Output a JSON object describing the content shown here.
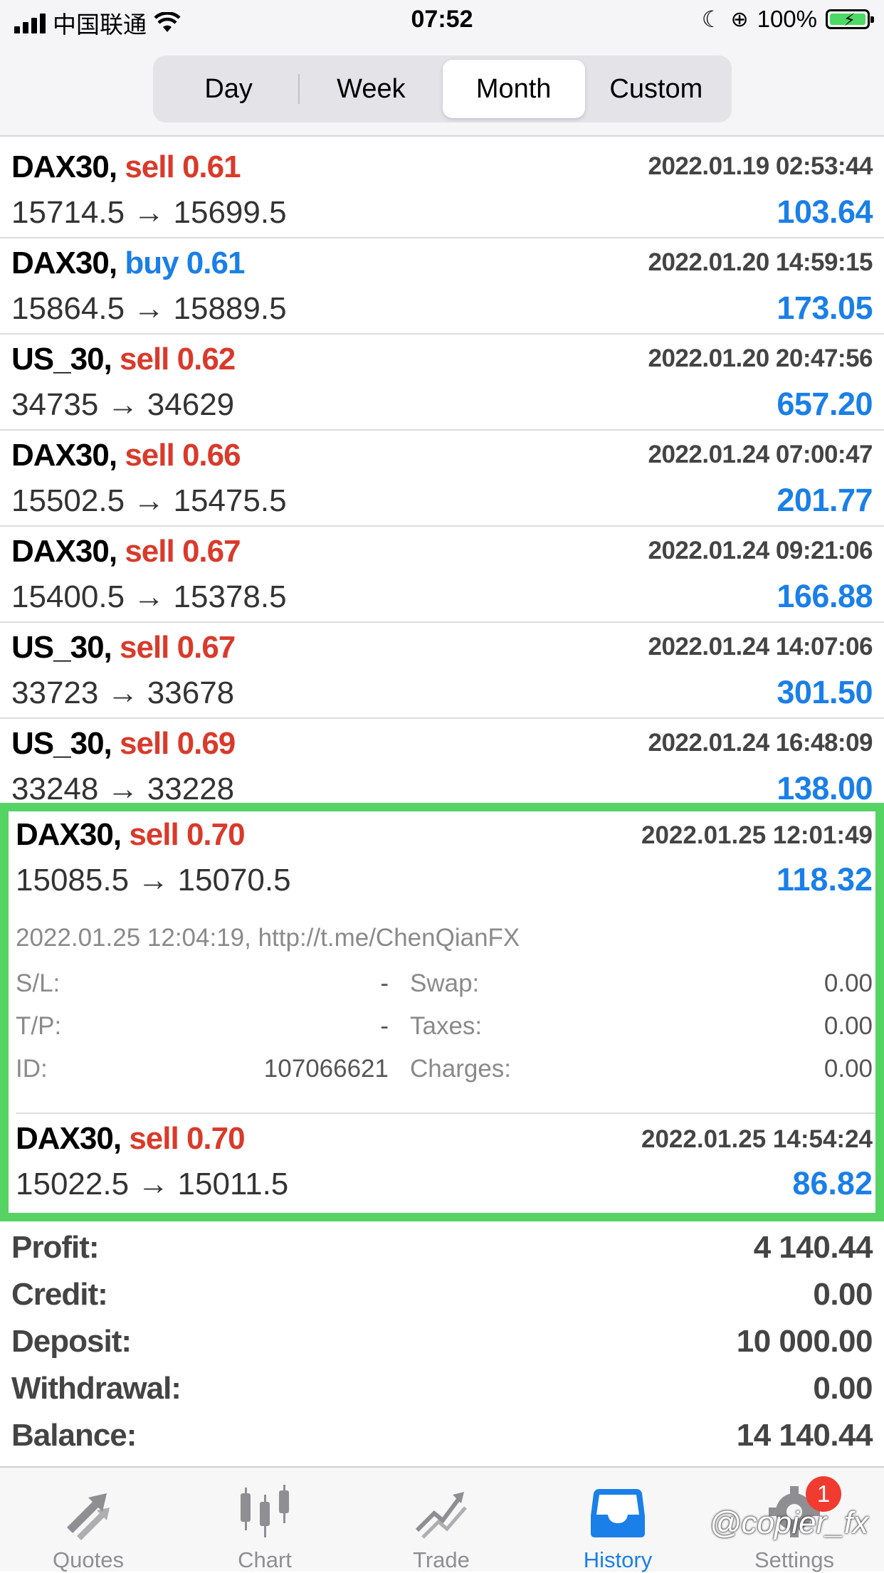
{
  "status_bar": {
    "carrier": "中国联通",
    "time": "07:52",
    "battery": "100%"
  },
  "segments": [
    {
      "label": "Day",
      "active": false
    },
    {
      "label": "Week",
      "active": false
    },
    {
      "label": "Month",
      "active": true
    },
    {
      "label": "Custom",
      "active": false
    }
  ],
  "deals": [
    {
      "symbol": "DAX30,",
      "side": "sell",
      "volume": "0.61",
      "time": "2022.01.19 02:53:44",
      "prices": "15714.5 → 15699.5",
      "profit": "103.64"
    },
    {
      "symbol": "DAX30,",
      "side": "buy",
      "volume": "0.61",
      "time": "2022.01.20 14:59:15",
      "prices": "15864.5 → 15889.5",
      "profit": "173.05"
    },
    {
      "symbol": "US_30,",
      "side": "sell",
      "volume": "0.62",
      "time": "2022.01.20 20:47:56",
      "prices": "34735 → 34629",
      "profit": "657.20"
    },
    {
      "symbol": "DAX30,",
      "side": "sell",
      "volume": "0.66",
      "time": "2022.01.24 07:00:47",
      "prices": "15502.5 → 15475.5",
      "profit": "201.77"
    },
    {
      "symbol": "DAX30,",
      "side": "sell",
      "volume": "0.67",
      "time": "2022.01.24 09:21:06",
      "prices": "15400.5 → 15378.5",
      "profit": "166.88"
    },
    {
      "symbol": "US_30,",
      "side": "sell",
      "volume": "0.67",
      "time": "2022.01.24 14:07:06",
      "prices": "33723 → 33678",
      "profit": "301.50"
    },
    {
      "symbol": "US_30,",
      "side": "sell",
      "volume": "0.69",
      "time": "2022.01.24 16:48:09",
      "prices": "33248 → 33228",
      "profit": "138.00"
    }
  ],
  "expanded": {
    "symbol": "DAX30,",
    "side": "sell",
    "volume": "0.70",
    "time": "2022.01.25 12:01:49",
    "prices": "15085.5 → 15070.5",
    "profit": "118.32",
    "comment": "2022.01.25 12:04:19, http://t.me/ChenQianFX",
    "sl_label": "S/L:",
    "sl_value": "-",
    "tp_label": "T/P:",
    "tp_value": "-",
    "id_label": "ID:",
    "id_value": "107066621",
    "swap_label": "Swap:",
    "swap_value": "0.00",
    "taxes_label": "Taxes:",
    "taxes_value": "0.00",
    "charges_label": "Charges:",
    "charges_value": "0.00"
  },
  "last_deal": {
    "symbol": "DAX30,",
    "side": "sell",
    "volume": "0.70",
    "time": "2022.01.25 14:54:24",
    "prices": "15022.5 → 15011.5",
    "profit": "86.82"
  },
  "summary": [
    {
      "label": "Profit:",
      "value": "4 140.44"
    },
    {
      "label": "Credit:",
      "value": "0.00"
    },
    {
      "label": "Deposit:",
      "value": "10 000.00"
    },
    {
      "label": "Withdrawal:",
      "value": "0.00"
    },
    {
      "label": "Balance:",
      "value": "14 140.44"
    }
  ],
  "tabs": [
    {
      "label": "Quotes",
      "icon": "quotes-arrows-icon",
      "active": false
    },
    {
      "label": "Chart",
      "icon": "candlestick-icon",
      "active": false
    },
    {
      "label": "Trade",
      "icon": "trade-trend-icon",
      "active": false
    },
    {
      "label": "History",
      "icon": "inbox-tray-icon",
      "active": true
    },
    {
      "label": "Settings",
      "icon": "gear-icon",
      "active": false,
      "badge": "1"
    }
  ],
  "watermark": "@copier_fx",
  "colors": {
    "sell": "#d93a2b",
    "buy": "#1a7fe8",
    "profit": "#1a7fe8",
    "highlight": "#55d464",
    "active_tab": "#1a7fe8"
  }
}
